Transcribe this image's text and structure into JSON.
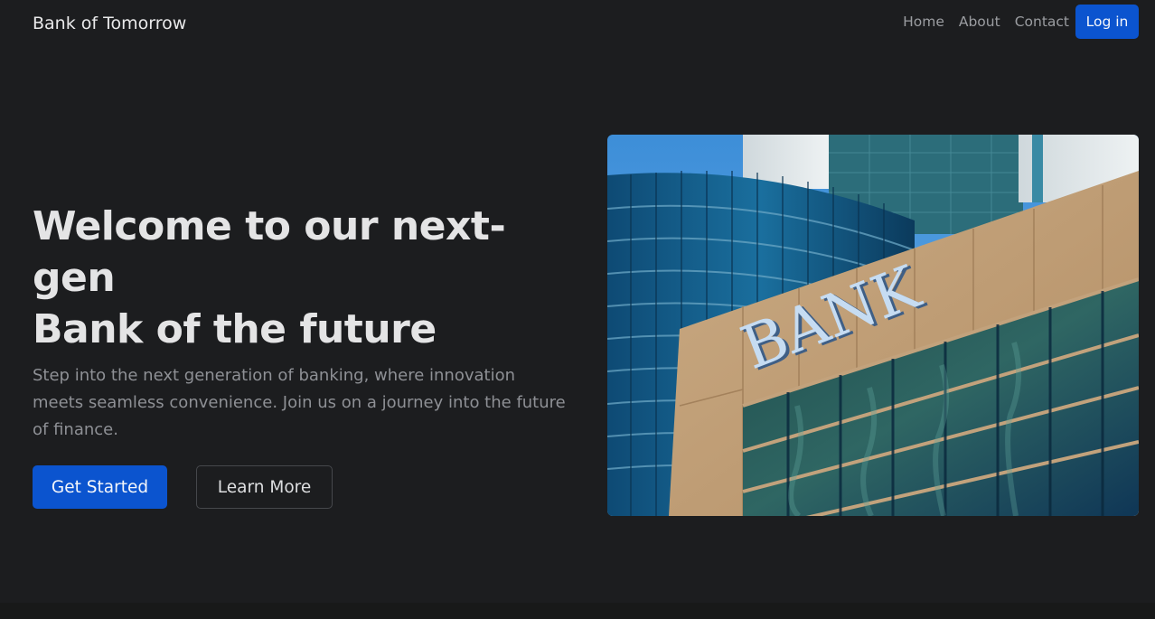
{
  "navbar": {
    "brand": "Bank of Tomorrow",
    "links": [
      "Home",
      "About",
      "Contact"
    ],
    "login_label": "Log in"
  },
  "hero": {
    "title_line1": "Welcome to our next-gen",
    "title_line2": "Bank of the future",
    "description": "Step into the next generation of banking, where innovation meets seamless convenience. Join us on a journey into the future of finance.",
    "primary_cta": "Get Started",
    "secondary_cta": "Learn More"
  },
  "image": {
    "sign_text": "BANK"
  },
  "colors": {
    "background": "#1c1d1f",
    "accent": "#0b54cf",
    "heading": "#e4e4e5",
    "muted_text": "#8e9095"
  }
}
